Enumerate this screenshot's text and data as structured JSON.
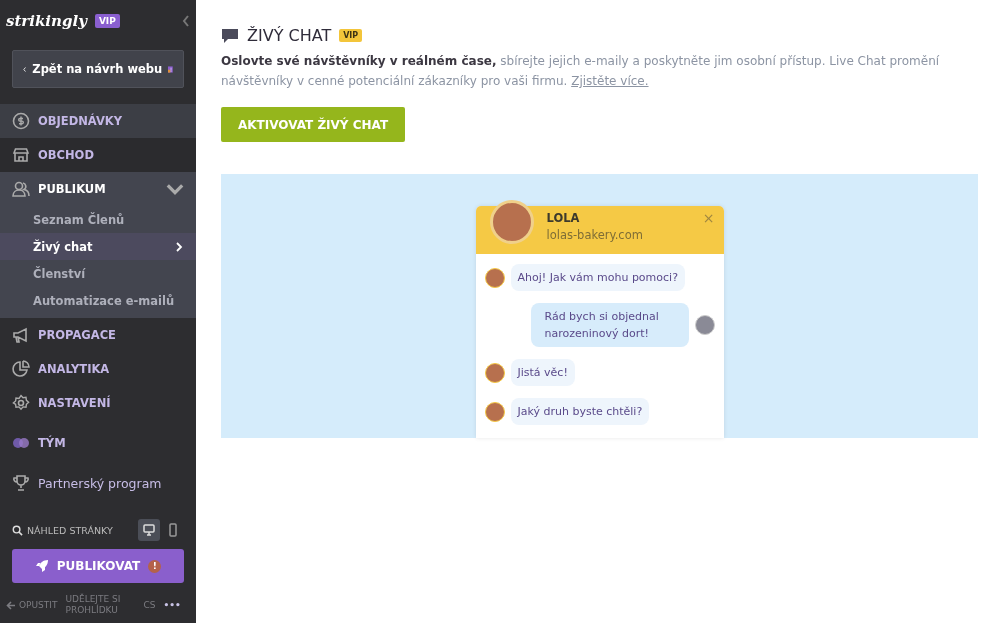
{
  "sidebar": {
    "logo": "strikingly",
    "logo_badge": "VIP",
    "back_button": "Zpět na návrh webu",
    "nav": [
      {
        "label": "OBJEDNÁVKY",
        "kind": "section",
        "selected": false
      },
      {
        "label": "OBCHOD",
        "kind": "section",
        "selected": false
      },
      {
        "label": "PUBLIKUM",
        "kind": "group",
        "expanded": true,
        "children": [
          {
            "label": "Seznam Členů",
            "selected": false
          },
          {
            "label": "Živý chat",
            "selected": true
          },
          {
            "label": "Členství",
            "selected": false
          },
          {
            "label": "Automatizace e-mailů",
            "selected": false
          }
        ]
      },
      {
        "label": "PROPAGACE",
        "kind": "section",
        "selected": false
      },
      {
        "label": "ANALYTIKA",
        "kind": "section",
        "selected": false
      },
      {
        "label": "NASTAVENÍ",
        "kind": "section",
        "selected": false
      },
      {
        "label": "TÝM",
        "kind": "section",
        "selected": false
      },
      {
        "label": "Partnerský program",
        "kind": "plain",
        "selected": false
      }
    ],
    "preview_label": "NÁHLED STRÁNKY",
    "preview_devices": [
      {
        "selected": true
      },
      {
        "selected": false
      }
    ],
    "publish_button": "PUBLIKOVAT",
    "publish_warning": "!",
    "footer": {
      "exit": "OPUSTIT",
      "tour": "UDĚLEJTE SI PROHLÍDKU",
      "language": "CS",
      "more": "•••"
    }
  },
  "main": {
    "title": "ŽIVÝ CHAT",
    "title_badge": "VIP",
    "description": "**Oslovte své návštěvníky v reálném čase,** sbírejte jejich e-maily a poskytněte jim osobní přístup. Live Chat promění návštěvníky v cenné potenciální zákazníky pro vaši firmu.",
    "learn_more": "Zjistěte více.",
    "activate_button": "AKTIVOVAT ŽIVÝ CHAT",
    "chat_preview": {
      "name": "LOLA",
      "site": "lolas-bakery.com",
      "close": "×",
      "messages": [
        {
          "kind": "agent",
          "text": "Ahoj! Jak vám mohu pomoci?"
        },
        {
          "kind": "visitor",
          "text": "Rád bych si objednal narozeninový dort!"
        },
        {
          "kind": "agent",
          "text": "Jistá věc!"
        },
        {
          "kind": "agent",
          "text": "Jaký druh byste chtěli?"
        }
      ]
    }
  }
}
